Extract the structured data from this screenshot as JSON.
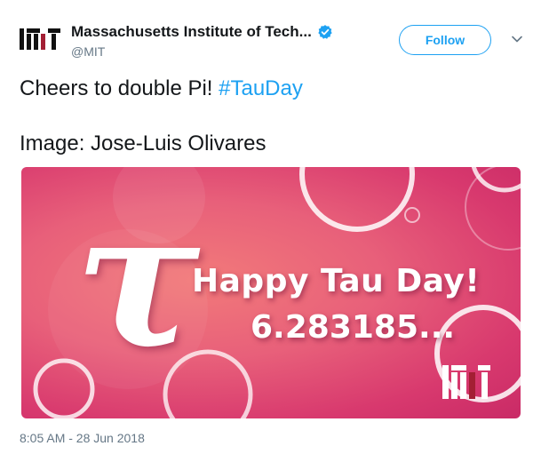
{
  "account": {
    "display_name": "Massachusetts Institute of Tech...",
    "handle": "@MIT",
    "avatar_icon": "mit-logo-icon",
    "verified_icon": "verified-badge-icon"
  },
  "actions": {
    "follow_label": "Follow",
    "menu_icon": "chevron-down-icon"
  },
  "tweet": {
    "text_prefix": "Cheers to double Pi! ",
    "hashtag": "#TauDay",
    "credit": "Image: Jose-Luis Olivares",
    "timestamp": "8:05 AM - 28 Jun 2018"
  },
  "media": {
    "glyph": "τ",
    "headline": "Happy Tau Day!",
    "number": "6.283185...",
    "logo_icon": "mit-logo-icon"
  },
  "colors": {
    "link": "#1da1f2",
    "text": "#14171a",
    "muted": "#657786",
    "mit_red": "#a31f34"
  }
}
